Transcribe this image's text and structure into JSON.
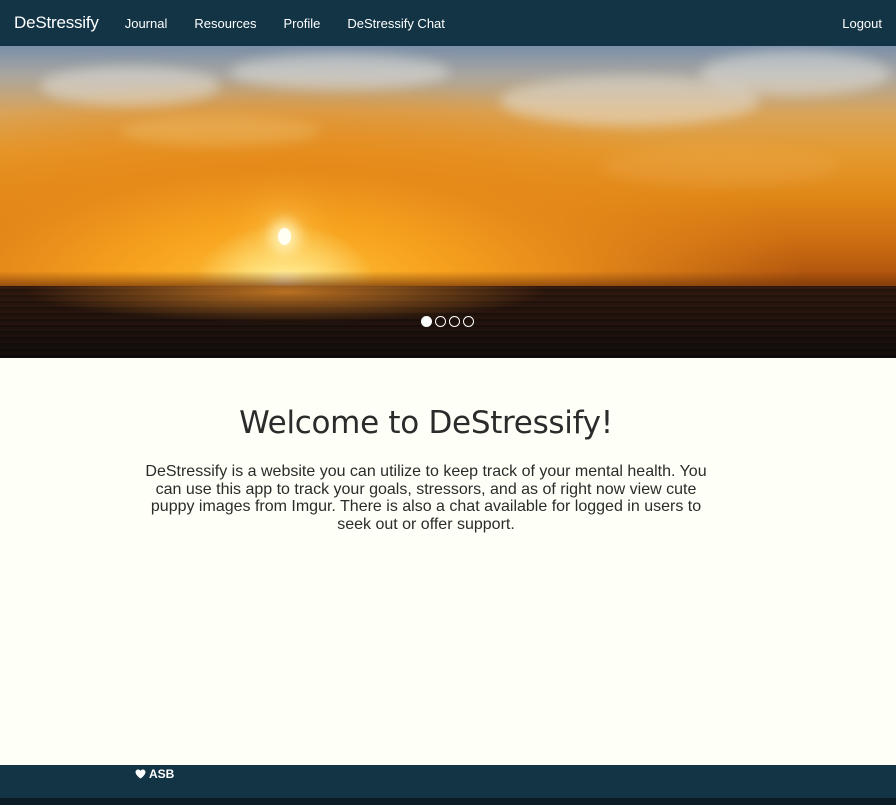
{
  "navbar": {
    "brand": "DeStressify",
    "links": [
      "Journal",
      "Resources",
      "Profile",
      "DeStressify Chat"
    ],
    "logout": "Logout"
  },
  "carousel": {
    "slide_count": 4,
    "active_index": 0
  },
  "main": {
    "title": "Welcome to DeStressify!",
    "description": "DeStressify is a website you can utilize to keep track of your mental health. You can use this app to track your goals, stressors, and as of right now view cute puppy images from Imgur. There is also a chat available for logged in users to seek out or offer support."
  },
  "footer": {
    "icon": "heart-icon",
    "credit": "ASB"
  },
  "colors": {
    "navbar_bg": "#123445",
    "page_bg": "#fefff6",
    "text": "#2b2b2b"
  }
}
